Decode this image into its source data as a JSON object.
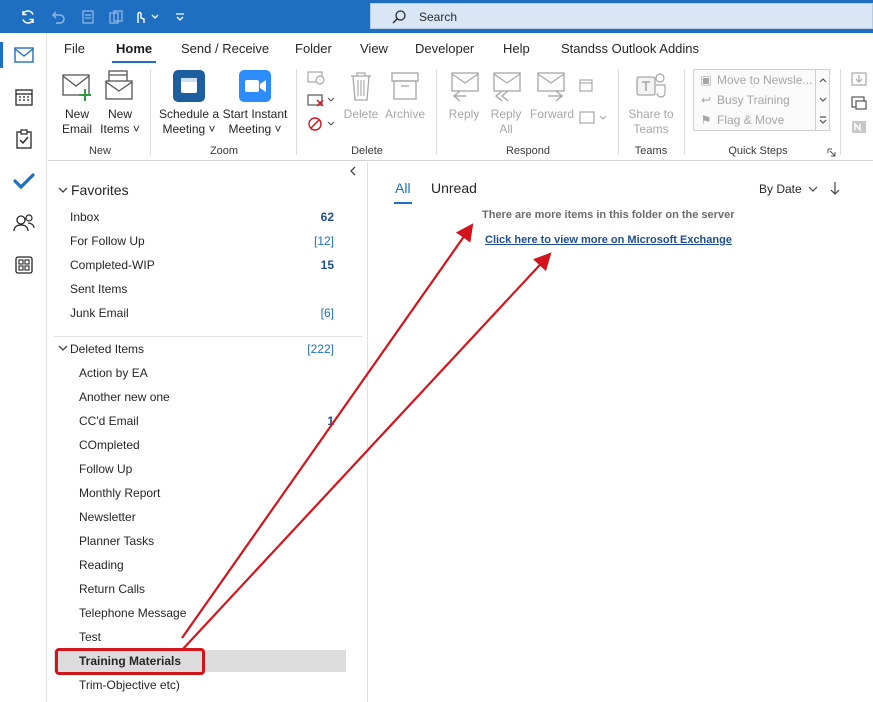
{
  "search": {
    "placeholder": "Search"
  },
  "tabs": [
    "File",
    "Home",
    "Send / Receive",
    "Folder",
    "View",
    "Developer",
    "Help",
    "Standss Outlook Addins"
  ],
  "active_tab": "Home",
  "ribbon": {
    "new_email": [
      "New",
      "Email"
    ],
    "new_items": [
      "New",
      "Items ˅"
    ],
    "schedule_meeting": [
      "Schedule a",
      "Meeting ˅"
    ],
    "start_instant_meeting": [
      "Start Instant",
      "Meeting ˅"
    ],
    "delete": "Delete",
    "archive": "Archive",
    "reply": "Reply",
    "reply_all": [
      "Reply",
      "All"
    ],
    "forward": "Forward",
    "share_to_teams": [
      "Share to",
      "Teams"
    ],
    "groups": {
      "new": "New",
      "zoom": "Zoom",
      "delete": "Delete",
      "respond": "Respond",
      "teams": "Teams",
      "quick_steps": "Quick Steps"
    },
    "quick_steps": [
      "Move to Newsle...",
      "Busy Training",
      "Flag & Move"
    ]
  },
  "folders": {
    "favorites_header": "Favorites",
    "favorites": [
      {
        "label": "Inbox",
        "count": "62",
        "bold": true
      },
      {
        "label": "For Follow Up",
        "count": "[12]",
        "bold": false
      },
      {
        "label": "Completed-WIP",
        "count": "15",
        "bold": true
      },
      {
        "label": "Sent Items",
        "count": "",
        "bold": false
      },
      {
        "label": "Junk Email",
        "count": "[6]",
        "bold": false
      }
    ],
    "deleted_items": {
      "label": "Deleted Items",
      "count": "[222]"
    },
    "subfolders": [
      {
        "label": "Action by EA",
        "count": ""
      },
      {
        "label": "Another new one",
        "count": ""
      },
      {
        "label": "CC'd Email",
        "count": "1"
      },
      {
        "label": "COmpleted",
        "count": ""
      },
      {
        "label": "Follow Up",
        "count": ""
      },
      {
        "label": "Monthly Report",
        "count": ""
      },
      {
        "label": "Newsletter",
        "count": ""
      },
      {
        "label": "Planner Tasks",
        "count": ""
      },
      {
        "label": "Reading",
        "count": ""
      },
      {
        "label": "Return Calls",
        "count": ""
      },
      {
        "label": "Telephone Message",
        "count": ""
      },
      {
        "label": "Test",
        "count": ""
      },
      {
        "label": "Training Materials",
        "count": "",
        "selected": true
      },
      {
        "label": "Trim-Objective etc)",
        "count": ""
      }
    ]
  },
  "message_list": {
    "tab_all": "All",
    "tab_unread": "Unread",
    "sort": "By Date",
    "server_note": "There are more items in this folder on the server",
    "exchange_link": "Click here to view more on Microsoft Exchange"
  },
  "colors": {
    "accent": "#1e6fc2",
    "annotation": "#d4141c",
    "selected_row": "#dcdcdc"
  }
}
